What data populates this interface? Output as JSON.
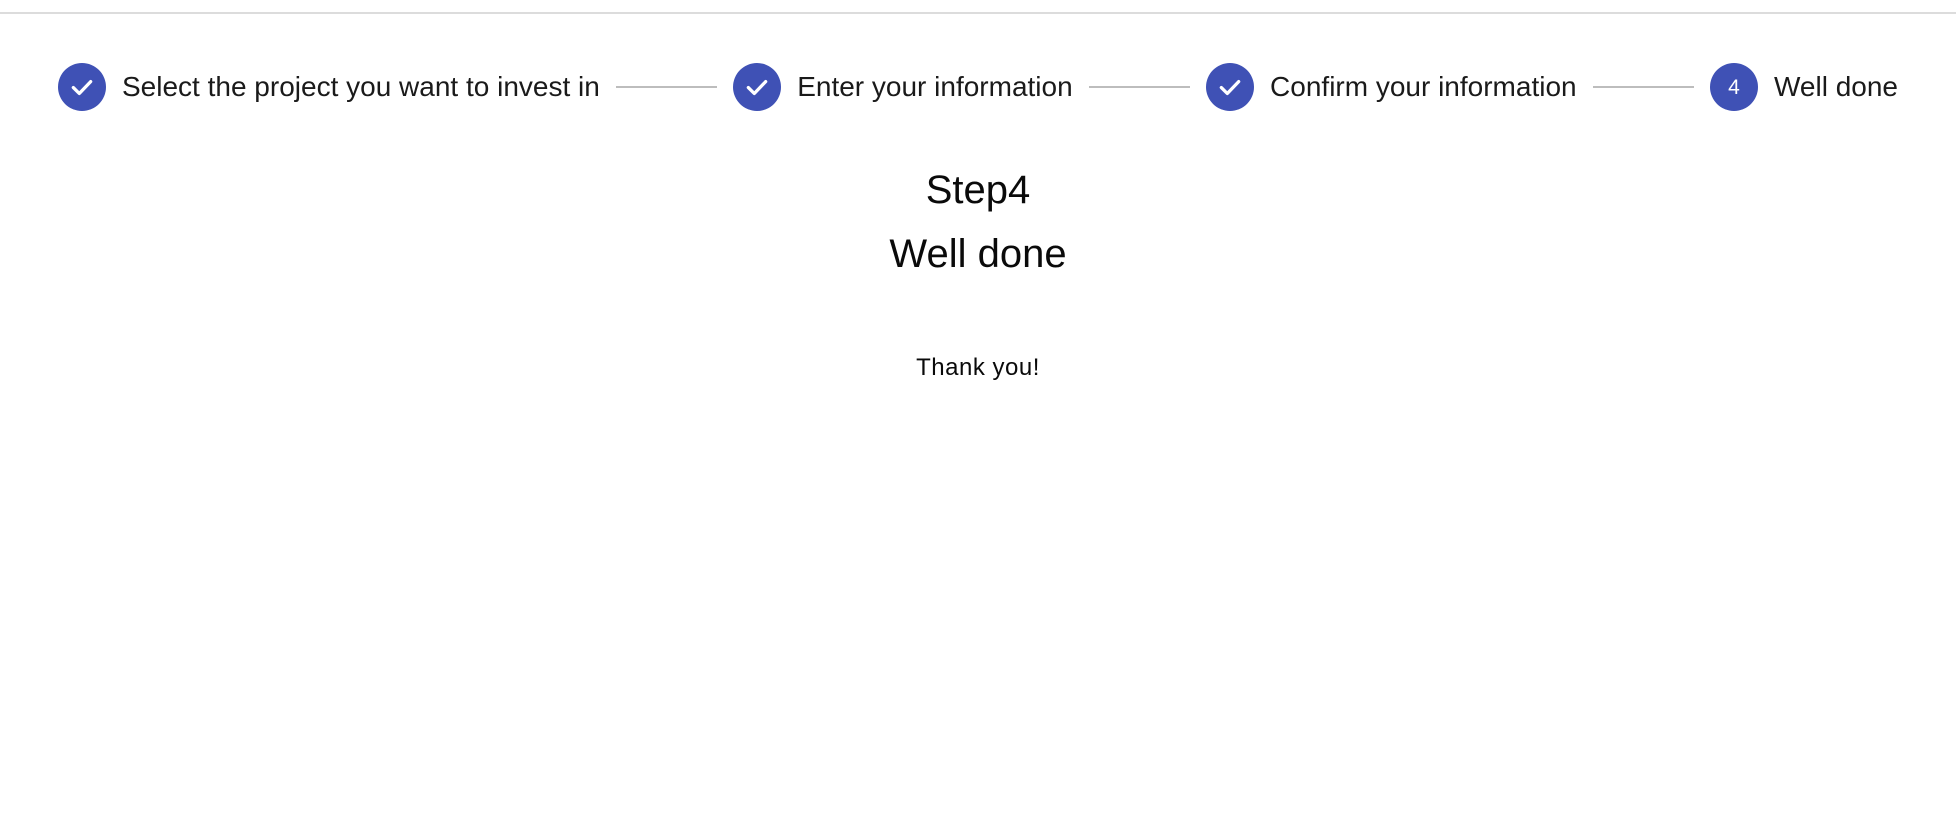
{
  "colors": {
    "accent": "#3f51b5",
    "connector": "#bdbdbd",
    "top_rule": "#dcdcdc"
  },
  "stepper": {
    "steps": [
      {
        "label": "Select the project you want to invest in",
        "state": "completed",
        "icon": "check-icon"
      },
      {
        "label": "Enter your information",
        "state": "completed",
        "icon": "check-icon"
      },
      {
        "label": "Confirm your information",
        "state": "completed",
        "icon": "check-icon"
      },
      {
        "label": "Well done",
        "state": "active",
        "number": "4"
      }
    ]
  },
  "content": {
    "step_heading": "Step4",
    "step_title": "Well done",
    "message": "Thank you!"
  }
}
